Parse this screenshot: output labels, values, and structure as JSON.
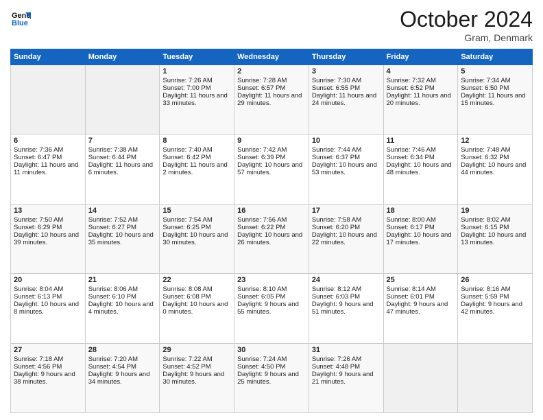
{
  "header": {
    "logo_line1": "General",
    "logo_line2": "Blue",
    "month": "October 2024",
    "location": "Gram, Denmark"
  },
  "days_of_week": [
    "Sunday",
    "Monday",
    "Tuesday",
    "Wednesday",
    "Thursday",
    "Friday",
    "Saturday"
  ],
  "weeks": [
    [
      {
        "day": "",
        "sunrise": "",
        "sunset": "",
        "daylight": ""
      },
      {
        "day": "",
        "sunrise": "",
        "sunset": "",
        "daylight": ""
      },
      {
        "day": "1",
        "sunrise": "Sunrise: 7:26 AM",
        "sunset": "Sunset: 7:00 PM",
        "daylight": "Daylight: 11 hours and 33 minutes."
      },
      {
        "day": "2",
        "sunrise": "Sunrise: 7:28 AM",
        "sunset": "Sunset: 6:57 PM",
        "daylight": "Daylight: 11 hours and 29 minutes."
      },
      {
        "day": "3",
        "sunrise": "Sunrise: 7:30 AM",
        "sunset": "Sunset: 6:55 PM",
        "daylight": "Daylight: 11 hours and 24 minutes."
      },
      {
        "day": "4",
        "sunrise": "Sunrise: 7:32 AM",
        "sunset": "Sunset: 6:52 PM",
        "daylight": "Daylight: 11 hours and 20 minutes."
      },
      {
        "day": "5",
        "sunrise": "Sunrise: 7:34 AM",
        "sunset": "Sunset: 6:50 PM",
        "daylight": "Daylight: 11 hours and 15 minutes."
      }
    ],
    [
      {
        "day": "6",
        "sunrise": "Sunrise: 7:36 AM",
        "sunset": "Sunset: 6:47 PM",
        "daylight": "Daylight: 11 hours and 11 minutes."
      },
      {
        "day": "7",
        "sunrise": "Sunrise: 7:38 AM",
        "sunset": "Sunset: 6:44 PM",
        "daylight": "Daylight: 11 hours and 6 minutes."
      },
      {
        "day": "8",
        "sunrise": "Sunrise: 7:40 AM",
        "sunset": "Sunset: 6:42 PM",
        "daylight": "Daylight: 11 hours and 2 minutes."
      },
      {
        "day": "9",
        "sunrise": "Sunrise: 7:42 AM",
        "sunset": "Sunset: 6:39 PM",
        "daylight": "Daylight: 10 hours and 57 minutes."
      },
      {
        "day": "10",
        "sunrise": "Sunrise: 7:44 AM",
        "sunset": "Sunset: 6:37 PM",
        "daylight": "Daylight: 10 hours and 53 minutes."
      },
      {
        "day": "11",
        "sunrise": "Sunrise: 7:46 AM",
        "sunset": "Sunset: 6:34 PM",
        "daylight": "Daylight: 10 hours and 48 minutes."
      },
      {
        "day": "12",
        "sunrise": "Sunrise: 7:48 AM",
        "sunset": "Sunset: 6:32 PM",
        "daylight": "Daylight: 10 hours and 44 minutes."
      }
    ],
    [
      {
        "day": "13",
        "sunrise": "Sunrise: 7:50 AM",
        "sunset": "Sunset: 6:29 PM",
        "daylight": "Daylight: 10 hours and 39 minutes."
      },
      {
        "day": "14",
        "sunrise": "Sunrise: 7:52 AM",
        "sunset": "Sunset: 6:27 PM",
        "daylight": "Daylight: 10 hours and 35 minutes."
      },
      {
        "day": "15",
        "sunrise": "Sunrise: 7:54 AM",
        "sunset": "Sunset: 6:25 PM",
        "daylight": "Daylight: 10 hours and 30 minutes."
      },
      {
        "day": "16",
        "sunrise": "Sunrise: 7:56 AM",
        "sunset": "Sunset: 6:22 PM",
        "daylight": "Daylight: 10 hours and 26 minutes."
      },
      {
        "day": "17",
        "sunrise": "Sunrise: 7:58 AM",
        "sunset": "Sunset: 6:20 PM",
        "daylight": "Daylight: 10 hours and 22 minutes."
      },
      {
        "day": "18",
        "sunrise": "Sunrise: 8:00 AM",
        "sunset": "Sunset: 6:17 PM",
        "daylight": "Daylight: 10 hours and 17 minutes."
      },
      {
        "day": "19",
        "sunrise": "Sunrise: 8:02 AM",
        "sunset": "Sunset: 6:15 PM",
        "daylight": "Daylight: 10 hours and 13 minutes."
      }
    ],
    [
      {
        "day": "20",
        "sunrise": "Sunrise: 8:04 AM",
        "sunset": "Sunset: 6:13 PM",
        "daylight": "Daylight: 10 hours and 8 minutes."
      },
      {
        "day": "21",
        "sunrise": "Sunrise: 8:06 AM",
        "sunset": "Sunset: 6:10 PM",
        "daylight": "Daylight: 10 hours and 4 minutes."
      },
      {
        "day": "22",
        "sunrise": "Sunrise: 8:08 AM",
        "sunset": "Sunset: 6:08 PM",
        "daylight": "Daylight: 10 hours and 0 minutes."
      },
      {
        "day": "23",
        "sunrise": "Sunrise: 8:10 AM",
        "sunset": "Sunset: 6:05 PM",
        "daylight": "Daylight: 9 hours and 55 minutes."
      },
      {
        "day": "24",
        "sunrise": "Sunrise: 8:12 AM",
        "sunset": "Sunset: 6:03 PM",
        "daylight": "Daylight: 9 hours and 51 minutes."
      },
      {
        "day": "25",
        "sunrise": "Sunrise: 8:14 AM",
        "sunset": "Sunset: 6:01 PM",
        "daylight": "Daylight: 9 hours and 47 minutes."
      },
      {
        "day": "26",
        "sunrise": "Sunrise: 8:16 AM",
        "sunset": "Sunset: 5:59 PM",
        "daylight": "Daylight: 9 hours and 42 minutes."
      }
    ],
    [
      {
        "day": "27",
        "sunrise": "Sunrise: 7:18 AM",
        "sunset": "Sunset: 4:56 PM",
        "daylight": "Daylight: 9 hours and 38 minutes."
      },
      {
        "day": "28",
        "sunrise": "Sunrise: 7:20 AM",
        "sunset": "Sunset: 4:54 PM",
        "daylight": "Daylight: 9 hours and 34 minutes."
      },
      {
        "day": "29",
        "sunrise": "Sunrise: 7:22 AM",
        "sunset": "Sunset: 4:52 PM",
        "daylight": "Daylight: 9 hours and 30 minutes."
      },
      {
        "day": "30",
        "sunrise": "Sunrise: 7:24 AM",
        "sunset": "Sunset: 4:50 PM",
        "daylight": "Daylight: 9 hours and 25 minutes."
      },
      {
        "day": "31",
        "sunrise": "Sunrise: 7:26 AM",
        "sunset": "Sunset: 4:48 PM",
        "daylight": "Daylight: 9 hours and 21 minutes."
      },
      {
        "day": "",
        "sunrise": "",
        "sunset": "",
        "daylight": ""
      },
      {
        "day": "",
        "sunrise": "",
        "sunset": "",
        "daylight": ""
      }
    ]
  ]
}
